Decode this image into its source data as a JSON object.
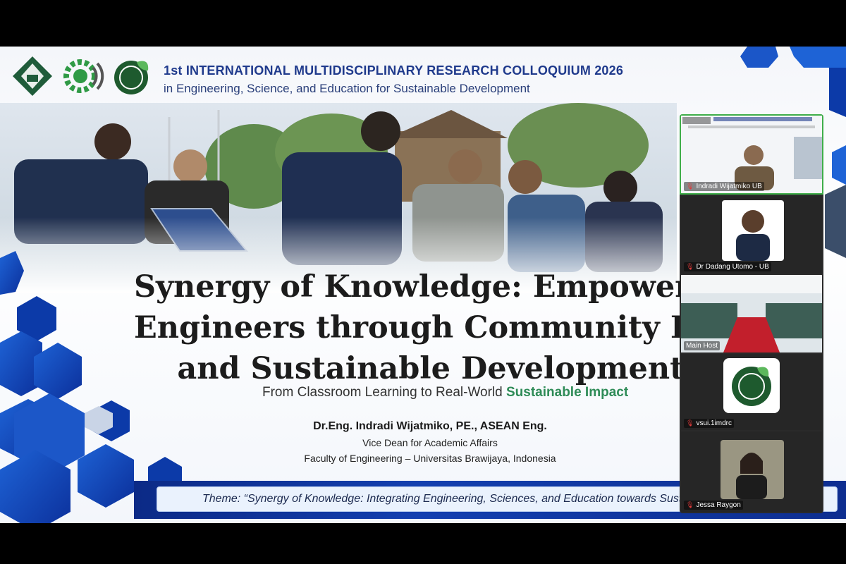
{
  "header": {
    "conference_title": "1st INTERNATIONAL MULTIDISCIPLINARY RESEARCH COLLOQUIUM 2026",
    "conference_subtitle": "in Engineering, Science, and Education for Sustainable Development",
    "logos": [
      "institution-logo",
      "gear-logo",
      "leaf-globe-logo"
    ]
  },
  "slide": {
    "title_lines": [
      "Synergy of Knowledge: Empowering",
      "Engineers through Community Engag",
      "and Sustainable Development"
    ],
    "subtitle_prefix": "From Classroom Learning to Real-World ",
    "subtitle_highlight": "Sustainable Impact",
    "speaker_name": "Dr.Eng. Indradi Wijatmiko, PE., ASEAN Eng.",
    "speaker_role": "Vice Dean for Academic Affairs",
    "speaker_faculty": "Faculty of Engineering – Universitas Brawijaya, Indonesia",
    "theme": "Theme: “Synergy of Knowledge: Integrating Engineering, Sciences, and Education towards Sustainable Development”"
  },
  "participants": [
    {
      "name": "Indradi Wijatmiko UB",
      "muted": false,
      "active_speaker": true
    },
    {
      "name": "Dr Dadang Utomo - UB",
      "muted": true
    },
    {
      "name": "Main Host",
      "muted": false
    },
    {
      "name": "vsui.1imdrc",
      "muted": true
    },
    {
      "name": "Jessa Raygon",
      "muted": true
    }
  ],
  "colors": {
    "accent_blue": "#1f3a8c",
    "highlight_green": "#2e8b57",
    "active_speaker_border": "#3fae4a",
    "mic_muted": "#e03a3a"
  }
}
